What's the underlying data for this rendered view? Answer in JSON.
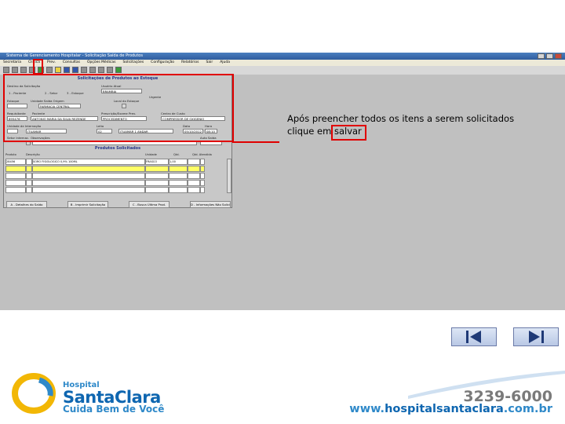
{
  "window": {
    "title": "Sistema de Gerenciamento Hospitalar - Solicitação Saída de Produtos",
    "menu": [
      "Secretaria",
      "Clínica",
      "Prev.",
      "Consultas",
      "Opções Médicas",
      "Solicitações",
      "Configuração",
      "Relatórios",
      "Sair",
      "Ajuda"
    ],
    "toolbar_yellow_label": "Salvar - Registro"
  },
  "form": {
    "title": "Solicitações de Produtos ao Estoque",
    "labels": {
      "destino": "Destino da Solicitação",
      "usuario_atual": "Usuário Atual",
      "estoque": "Estoque",
      "unidade_saida": "Unidade Saída Origem",
      "local_estoque": "Local do Estoque",
      "requisitante": "Requisitante",
      "paciente": "Paciente",
      "prescricao": "Prescrição/Exame Prev.",
      "centro_custo": "Centro de Custo",
      "unidade_internacao": "Unidade de Internação",
      "leito": "Leito",
      "data": "Data",
      "hora": "Hora",
      "observacoes": "Observações",
      "setor_internacao": "Setor Internac.",
      "auto_saida": "Auto Saída",
      "urgente": "Urgente"
    },
    "radio": [
      "1 - Paciente",
      "2 - Setor",
      "3 - Estoque"
    ],
    "values": {
      "usuario": "BRAMBIA",
      "estoque": "FARMACIA CENTRAL",
      "atendimento": "895476",
      "paciente": "ANTONIO MARIA DA SILVA REZENDE",
      "prescricao": "PROCEDIMENTO",
      "centro_custo": "COMPRESSOR DE OXIGENIO",
      "unidade": "ITUAMAR",
      "leito": "02",
      "setor": "ITUAMAR 1 ANDAR",
      "data": "05/10/2012",
      "hora": "08:10"
    }
  },
  "products": {
    "title": "Produtos Solicitados",
    "columns": [
      "Produto",
      "Descrição",
      "Unidade",
      "Qtd.",
      "Qtd. Atendida"
    ],
    "rows": [
      {
        "codigo": "28456",
        "descricao": "SORO FISIOLOGICO 0,9% 100ML",
        "unidade": "FRASCO",
        "qtd": "1,00",
        "selected": false
      },
      {
        "codigo": "",
        "descricao": "",
        "unidade": "",
        "qtd": "",
        "selected": true
      },
      {
        "codigo": "",
        "descricao": "",
        "unidade": "",
        "qtd": "",
        "selected": false
      },
      {
        "codigo": "",
        "descricao": "",
        "unidade": "",
        "qtd": "",
        "selected": false
      },
      {
        "codigo": "",
        "descricao": "",
        "unidade": "",
        "qtd": "",
        "selected": false
      }
    ],
    "buttons": [
      "A - Detalhes do Saldo",
      "B - Imprimir Solicitação",
      "C - Busca Última Prod.",
      "D - Informações Não Solicitado"
    ]
  },
  "instruction": {
    "line1": "Após preencher todos os itens a serem solicitados",
    "line2": "clique em salvar"
  },
  "navigation": {
    "prev_icon": "skip-back-icon",
    "next_icon": "skip-forward-icon"
  },
  "footer": {
    "hospital": "Hospital",
    "name": "SantaClara",
    "tagline": "Cuida Bem de Você",
    "phone": "3239-6000",
    "site_prefix": "www.",
    "site_main": "hospitalsantaclara",
    "site_suffix": ".com.br"
  },
  "colors": {
    "accent": "#0e66b0",
    "highlight": "#e00000",
    "selection": "#ffff66"
  }
}
